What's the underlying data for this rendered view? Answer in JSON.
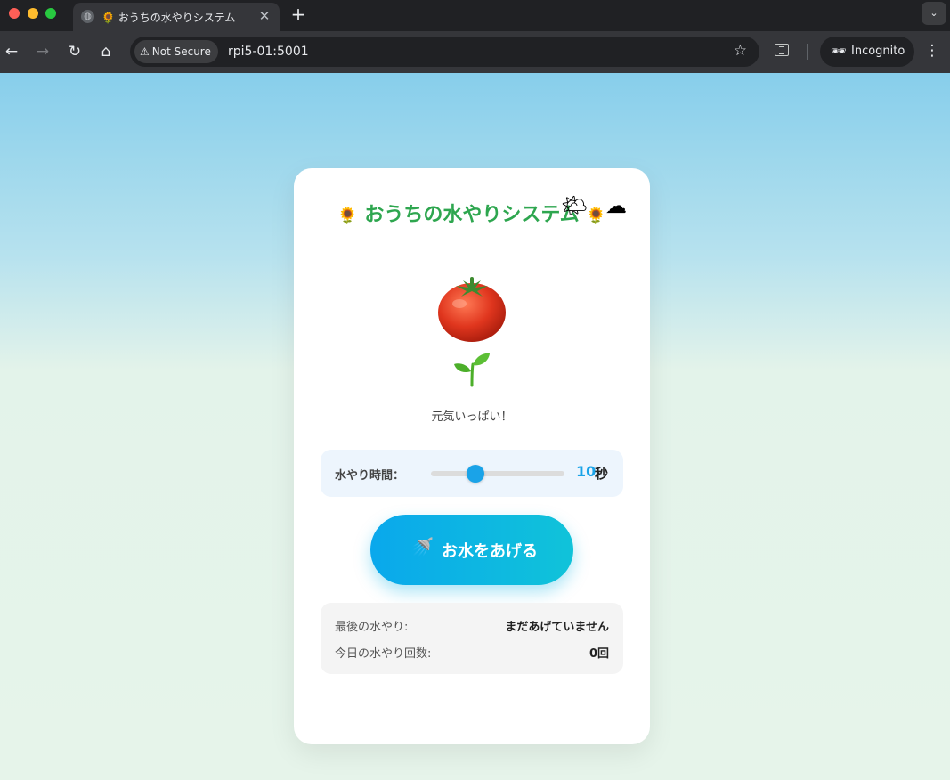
{
  "browser": {
    "tab_title": "🌻 おうちの水やりシステム",
    "tab_close": "✕",
    "new_tab": "+",
    "security_label": "Not Secure",
    "url": "rpi5-01:5001",
    "incognito_label": "Incognito"
  },
  "app": {
    "title": "おうちの水やりシステム",
    "title_flower": "🌻",
    "weather_icon": "🌤",
    "cloud_icon": "☁",
    "plant_status": "元気いっぱい！",
    "duration": {
      "label": "水やり時間：",
      "value": "10",
      "unit": "秒",
      "slider_fraction": 0.33
    },
    "water_button": {
      "icon": "🚿",
      "label": "お水をあげる"
    },
    "stats": {
      "last_watering_label": "最後の水やり:",
      "last_watering_value": "まだあげていません",
      "today_count_label": "今日の水やり回数:",
      "today_count_value": "0回"
    }
  },
  "colors": {
    "title": "#2ea64f",
    "accent": "#1aa3e8",
    "sky_top": "#87ceeb",
    "ground": "#e6f4ea"
  }
}
